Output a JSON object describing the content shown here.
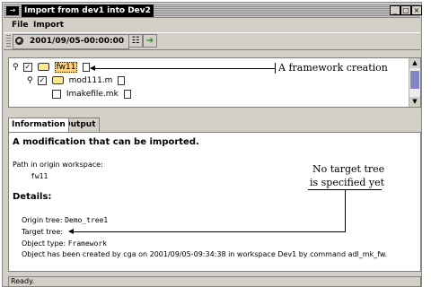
{
  "window": {
    "title": "Import from dev1 into Dev2"
  },
  "menu": [
    "File",
    "Import"
  ],
  "toolbar": {
    "date": "2001/09/05-00:00:00"
  },
  "tree": {
    "items": [
      {
        "label": "fw11"
      },
      {
        "label": "mod111.m"
      },
      {
        "label": "Imakefile.mk"
      }
    ]
  },
  "tabs": [
    "Information",
    "Output"
  ],
  "info": {
    "heading": "A modification that can be imported.",
    "path_label": "Path in origin workspace:",
    "path_value": "fw11",
    "details_heading": "Details:",
    "origin_label": "Origin tree:",
    "origin_value": "Demo_tree1",
    "target_label": "Target tree:",
    "type_label": "Object type:",
    "type_value": "Framework",
    "created_text": "Object has been created by cga on 2001/09/05-09:34:38 in workspace Dev1 by command adl_mk_fw."
  },
  "status": "Ready.",
  "annotations": {
    "framework": "A framework creation",
    "no_target_1": "No target tree",
    "no_target_2": "is specified yet"
  }
}
